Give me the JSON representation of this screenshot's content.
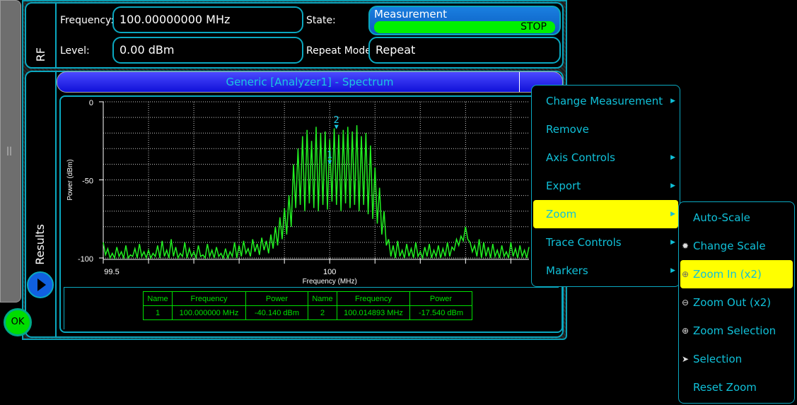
{
  "rf": {
    "section_label": "RF",
    "frequency_label": "Frequency:",
    "frequency_value": "100.00000000 MHz",
    "level_label": "Level:",
    "level_value": "0.00 dBm",
    "state_label": "State:",
    "state_button": "Measurement",
    "state_status": "STOP",
    "repeat_label": "Repeat Mode:",
    "repeat_value": "Repeat"
  },
  "results": {
    "section_label": "Results",
    "title": "Generic [Analyzer1] -  Spectrum",
    "ok_label": "OK",
    "grip": "||"
  },
  "marker_table": {
    "headers": [
      "Name",
      "Frequency",
      "Power",
      "Name",
      "Frequency",
      "Power"
    ],
    "row": [
      "1",
      "100.000000 MHz",
      "-40.140 dBm",
      "2",
      "100.014893 MHz",
      "-17.540 dBm"
    ]
  },
  "context_menu": {
    "items": [
      {
        "label": "Change Measurement",
        "submenu": true
      },
      {
        "label": "Remove",
        "submenu": false
      },
      {
        "label": "Axis Controls",
        "submenu": true
      },
      {
        "label": "Export",
        "submenu": true
      },
      {
        "label": "Zoom",
        "submenu": true,
        "highlighted": true
      },
      {
        "label": "Trace Controls",
        "submenu": true
      },
      {
        "label": "Markers",
        "submenu": true
      }
    ]
  },
  "zoom_submenu": {
    "items": [
      {
        "label": "Auto-Scale",
        "icon": ""
      },
      {
        "label": "Change Scale",
        "icon": "gear-icon"
      },
      {
        "label": "Zoom In (x2)",
        "icon": "zoom-in-magnifier-icon",
        "highlighted": true
      },
      {
        "label": "Zoom Out (x2)",
        "icon": "zoom-out-icon"
      },
      {
        "label": "Zoom Selection",
        "icon": "zoom-selection-icon"
      },
      {
        "label": "Selection",
        "icon": "pointer-icon"
      },
      {
        "label": "Reset Zoom",
        "icon": ""
      }
    ]
  },
  "colors": {
    "trace": "#22ee22",
    "marker": "#19c6e0",
    "highlight": "#ffff00",
    "accent": "#0aa8c0"
  },
  "chart_data": {
    "type": "line",
    "xlabel": "Frequency (MHz)",
    "ylabel": "Power (dBm)",
    "xlim": [
      99.5,
      100.44
    ],
    "ylim": [
      -100,
      0
    ],
    "grid": true,
    "xticks": [
      {
        "v": 99.5,
        "label": "99.5"
      },
      {
        "v": 100,
        "label": "100"
      }
    ],
    "yticks": [
      {
        "v": 0,
        "label": "0"
      },
      {
        "v": -50,
        "label": "-50"
      },
      {
        "v": -100,
        "label": "-100"
      }
    ],
    "series": [
      {
        "values": [
          -90,
          -98,
          -94,
          -100,
          -97,
          -100,
          -93,
          -99,
          -96,
          -100,
          -92,
          -100,
          -98,
          -99,
          -94,
          -100,
          -91,
          -99,
          -96,
          -100,
          -95,
          -100,
          -97,
          -99,
          -92,
          -100,
          -89,
          -99,
          -95,
          -100,
          -88,
          -99,
          -93,
          -100,
          -97,
          -99,
          -90,
          -100,
          -94,
          -99,
          -96,
          -100,
          -92,
          -99,
          -98,
          -100,
          -91,
          -99,
          -95,
          -100,
          -93,
          -99,
          -97,
          -100,
          -94,
          -100,
          -96,
          -99,
          -90,
          -100,
          -92,
          -99,
          -89,
          -97,
          -94,
          -99,
          -88,
          -96,
          -91,
          -98,
          -87,
          -95,
          -89,
          -97,
          -85,
          -94,
          -80,
          -92,
          -74,
          -88,
          -68,
          -85,
          -60,
          -80,
          -40,
          -68,
          -30,
          -66,
          -22,
          -70,
          -18,
          -65,
          -25,
          -68,
          -16,
          -70,
          -20,
          -66,
          -19,
          -69,
          -24,
          -64,
          -17,
          -66,
          -21,
          -70,
          -18,
          -65,
          -16,
          -68,
          -19,
          -66,
          -15,
          -70,
          -22,
          -66,
          -20,
          -72,
          -28,
          -75,
          -42,
          -78,
          -55,
          -85,
          -70,
          -92,
          -88,
          -99,
          -92,
          -100,
          -89,
          -99,
          -95,
          -100,
          -91,
          -99,
          -94,
          -100,
          -90,
          -99,
          -96,
          -100,
          -93,
          -99,
          -91,
          -100,
          -95,
          -99,
          -92,
          -100,
          -94,
          -99,
          -90,
          -99,
          -93,
          -95,
          -88,
          -92,
          -86,
          -89,
          -80,
          -88,
          -90,
          -96,
          -92,
          -99,
          -88,
          -100,
          -90,
          -99,
          -93,
          -100,
          -91,
          -99,
          -95,
          -100,
          -92,
          -99,
          -96,
          -100,
          -90,
          -99,
          -94,
          -100,
          -92,
          -99,
          -95,
          -100,
          -93
        ]
      }
    ],
    "markers": [
      {
        "name": "1",
        "x": 100.0,
        "y": -40.14
      },
      {
        "name": "2",
        "x": 100.014893,
        "y": -17.54
      }
    ]
  }
}
